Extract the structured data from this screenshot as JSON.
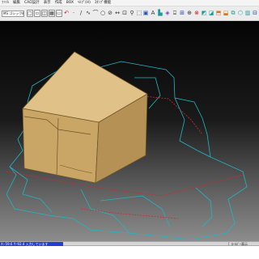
{
  "menubar": {
    "items": [
      {
        "label": "ﾌｧｲﾙ",
        "name": "menu-file"
      },
      {
        "label": "編集",
        "name": "menu-edit"
      },
      {
        "label": "CAD設計",
        "name": "menu-cad"
      },
      {
        "label": "表示",
        "name": "menu-view"
      },
      {
        "label": "作成",
        "name": "menu-create"
      },
      {
        "label": "BOX",
        "name": "menu-box"
      },
      {
        "label": "ﾍﾙﾌﾟ(H)",
        "name": "menu-help"
      },
      {
        "label": "ｽﾀﾝﾌﾟ機能",
        "name": "menu-stamp"
      }
    ]
  },
  "toolbar": {
    "font_value": "MS ゴシック新規",
    "left_tools": [
      {
        "glyph": "□",
        "icon": "new-file-icon",
        "style": "box"
      },
      {
        "glyph": "▫",
        "icon": "frame-icon",
        "style": "box"
      },
      {
        "glyph": "◫",
        "icon": "layout-icon",
        "style": "box"
      },
      {
        "glyph": "▦",
        "icon": "grid-icon",
        "style": "box"
      },
      {
        "glyph": "▭",
        "icon": "rect-icon",
        "style": "box"
      },
      {
        "glyph": "↶",
        "icon": "undo-icon",
        "style": "red"
      },
      {
        "glyph": "·",
        "icon": "point-icon",
        "style": ""
      },
      {
        "glyph": "/",
        "icon": "line-icon",
        "style": ""
      },
      {
        "glyph": "∿",
        "icon": "curve-icon",
        "style": ""
      },
      {
        "glyph": "⌒",
        "icon": "arc-icon",
        "style": ""
      },
      {
        "glyph": "○",
        "icon": "circle-icon",
        "style": ""
      },
      {
        "glyph": "⊘",
        "icon": "slot-icon",
        "style": ""
      },
      {
        "glyph": "↔",
        "icon": "dimension-icon",
        "style": ""
      },
      {
        "glyph": "⊡",
        "icon": "select-icon",
        "style": ""
      },
      {
        "glyph": "⚲",
        "icon": "search-icon",
        "style": ""
      },
      {
        "glyph": "⬚",
        "icon": "area-icon",
        "style": ""
      },
      {
        "glyph": "⤢",
        "icon": "move-icon",
        "style": ""
      },
      {
        "glyph": "⟲",
        "icon": "rotate-icon",
        "style": ""
      },
      {
        "glyph": "⇋",
        "icon": "mirror-icon",
        "style": ""
      },
      {
        "glyph": "▤",
        "icon": "table-icon",
        "style": ""
      }
    ],
    "right_tools": [
      {
        "glyph": "▣",
        "icon": "box-view-icon",
        "style": "blue"
      },
      {
        "glyph": "A",
        "icon": "text-icon",
        "style": ""
      },
      {
        "glyph": "▙",
        "icon": "fill-icon",
        "style": "teal"
      },
      {
        "glyph": "◈",
        "icon": "layer-icon",
        "style": "purple"
      },
      {
        "glyph": "⌹",
        "icon": "print-icon",
        "style": ""
      },
      {
        "glyph": "⊞",
        "icon": "snap-icon",
        "style": "blue"
      },
      {
        "glyph": "⊕",
        "icon": "zoom-icon",
        "style": ""
      },
      {
        "glyph": "⊗",
        "icon": "delete-icon",
        "style": "red"
      },
      {
        "glyph": "◩",
        "icon": "fold-icon",
        "style": "teal"
      },
      {
        "glyph": "◪",
        "icon": "unfold-icon",
        "style": "teal"
      },
      {
        "glyph": "⬒",
        "icon": "3d-box-icon",
        "style": "orange"
      },
      {
        "glyph": "⬓",
        "icon": "3d-open-icon",
        "style": "orange"
      },
      {
        "glyph": "⧉",
        "icon": "copy-icon",
        "style": "teal"
      },
      {
        "glyph": "⬡",
        "icon": "render-icon",
        "style": "teal"
      },
      {
        "glyph": "▥",
        "icon": "sheet-icon",
        "style": "teal"
      },
      {
        "glyph": "⊟",
        "icon": "window-icon",
        "style": "blue"
      },
      {
        "glyph": "✕",
        "icon": "close-view-icon",
        "style": ""
      }
    ]
  },
  "viewport": {
    "background_top": "#050505",
    "background_bottom": "#8c8c8c",
    "cut_line_color": "#1fb7c4",
    "crease_line_color": "#d8262e",
    "box_top_color": "#e0c187",
    "box_left_color": "#c9a665",
    "box_right_color": "#b69155",
    "box_edge_color": "#6f5427"
  },
  "statusbar": {
    "coords_text": "X:-59.6 Y:-92.4 入力しています",
    "mode_text": "ﾛｰﾙﾊﾞｰ表示"
  }
}
